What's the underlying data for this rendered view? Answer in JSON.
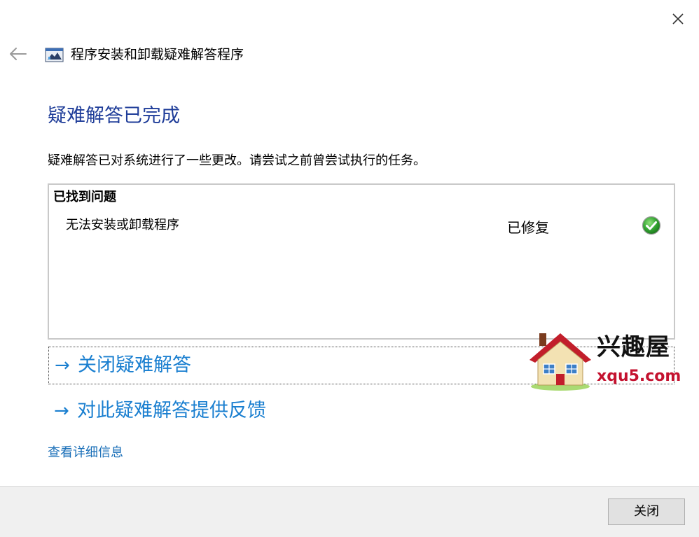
{
  "window": {
    "title": "程序安装和卸载疑难解答程序",
    "icons": {
      "back": "back-arrow-icon",
      "close": "close-icon",
      "app": "troubleshooter-app-icon"
    }
  },
  "main": {
    "heading": "疑难解答已完成",
    "description": "疑难解答已对系统进行了一些更改。请尝试之前曾尝试执行的任务。",
    "problems_section": {
      "header": "已找到问题",
      "items": [
        {
          "name": "无法安装或卸载程序",
          "status": "已修复",
          "status_icon": "green-check-icon"
        }
      ]
    },
    "links": {
      "arrow": "→",
      "close_troubleshooter": "关闭疑难解答",
      "feedback": "对此疑难解答提供反馈"
    },
    "details_link": "查看详细信息"
  },
  "watermark": {
    "brand_text": "兴趣屋",
    "url_text": "xqu5.com",
    "icon": "house-logo-icon"
  },
  "footer": {
    "close_button": "关闭"
  },
  "colors": {
    "heading": "#1f3d99",
    "link": "#1a7fd0",
    "footer_bg": "#f0f0f0",
    "success": "#2e9e2e",
    "watermark_red": "#c4122f"
  }
}
